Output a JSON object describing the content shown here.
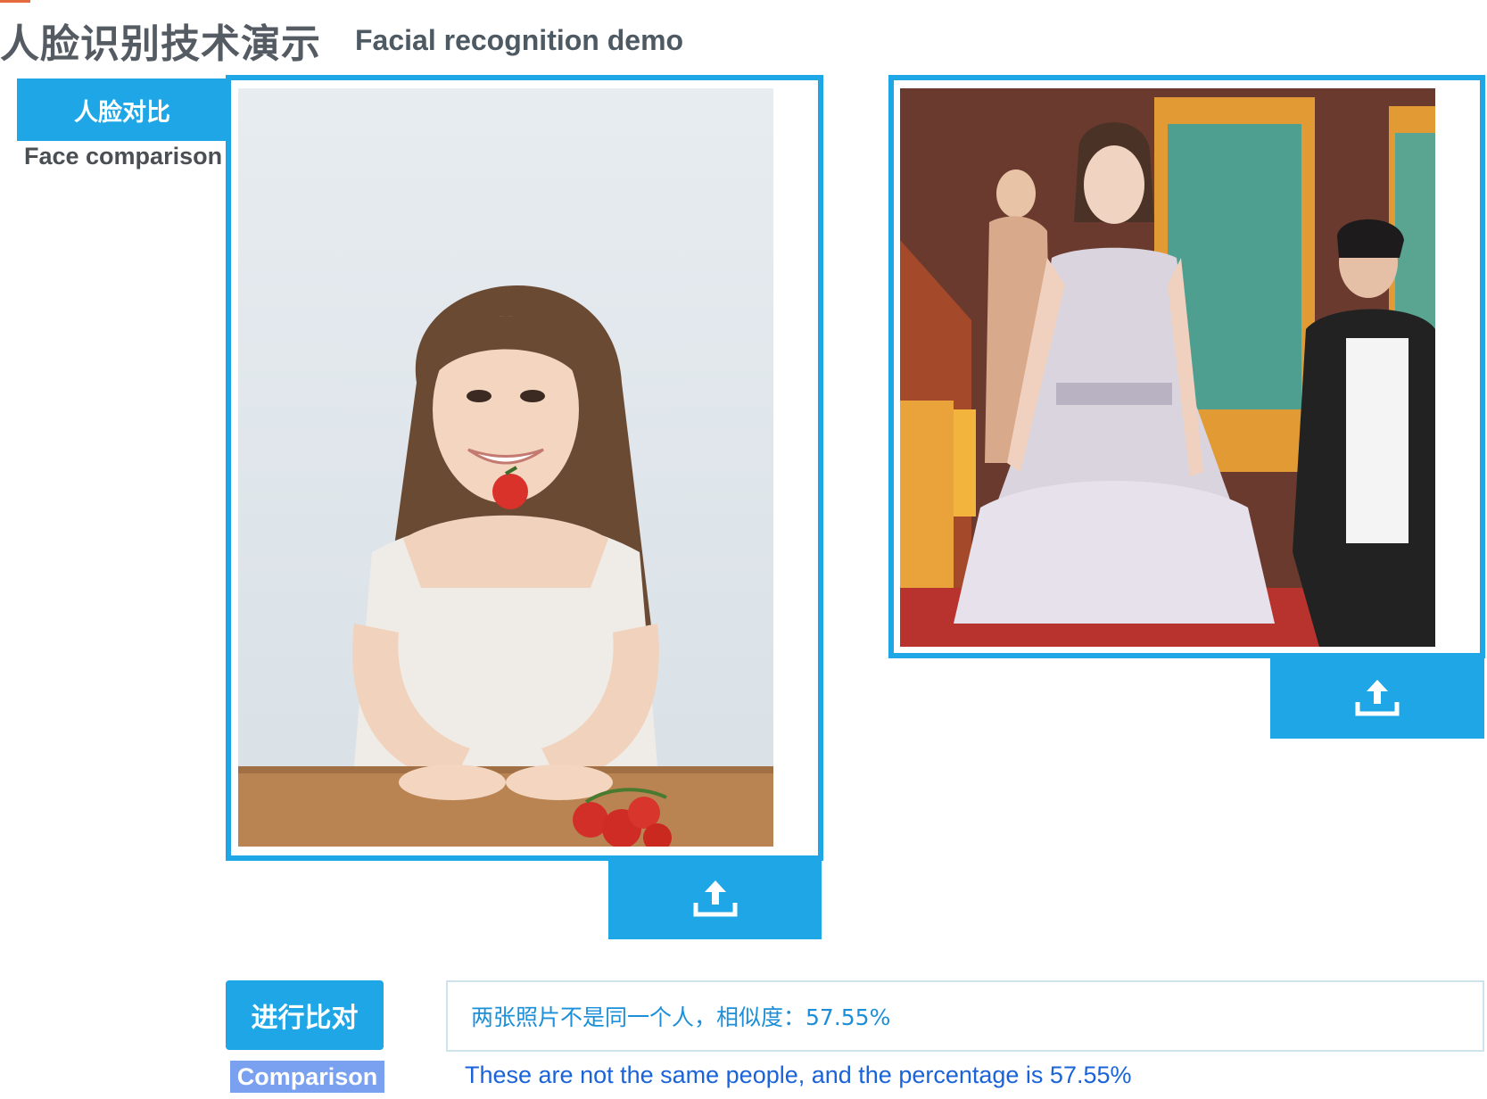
{
  "header": {
    "title_cn": "人脸识别技术演示",
    "title_en": "Facial recognition demo"
  },
  "sidebar": {
    "tab_label": "人脸对比",
    "tab_caption": "Face comparison"
  },
  "photos": {
    "left_icon": "upload-icon",
    "right_icon": "upload-icon"
  },
  "actions": {
    "compare_label": "进行比对",
    "compare_caption": "Comparison"
  },
  "result": {
    "message_cn": "两张照片不是同一个人，相似度：57.55%",
    "message_en": "These are not the same people, and the percentage is 57.55%"
  },
  "colors": {
    "accent": "#1ea6e6",
    "caption_bg": "#7aa0f0",
    "result_text": "#1c8fd8"
  }
}
